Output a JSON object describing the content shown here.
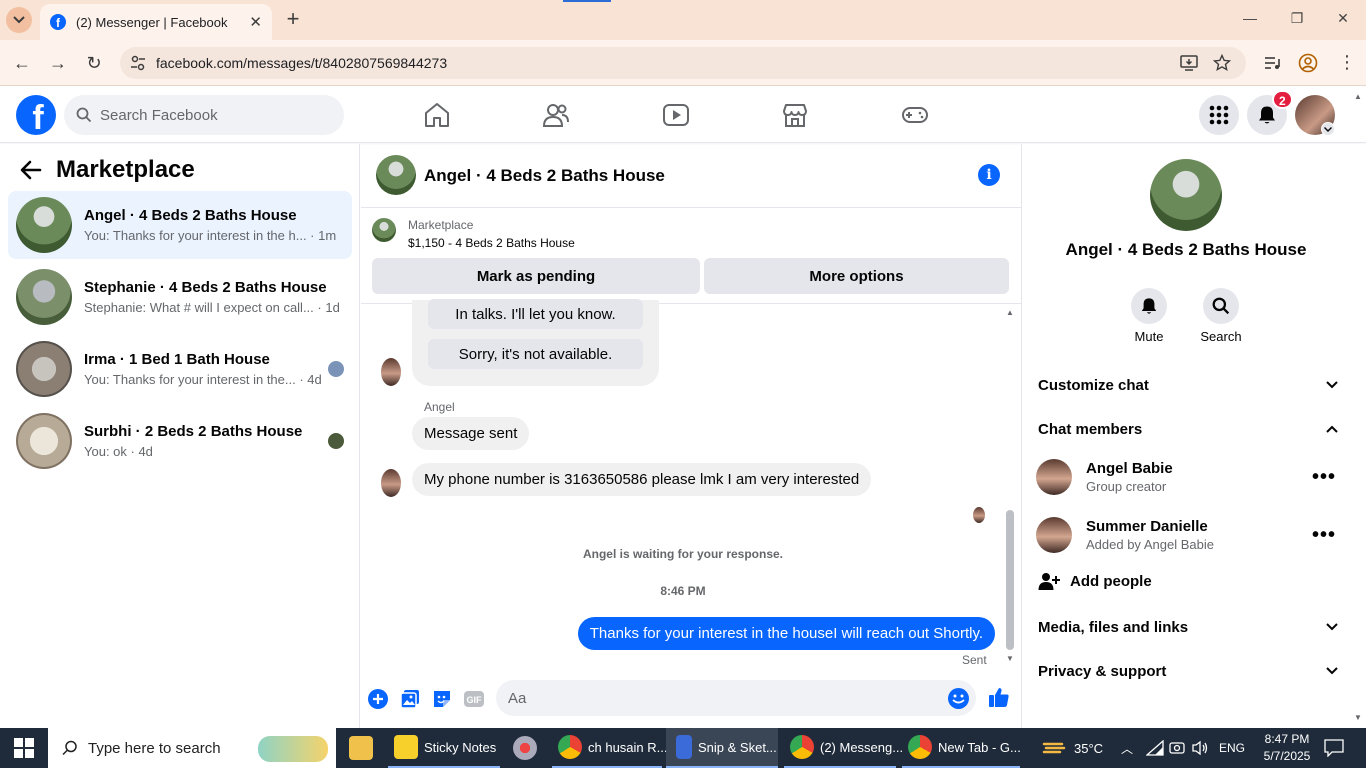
{
  "browser": {
    "tab_title": "(2) Messenger | Facebook",
    "close_tab": "✕",
    "new_tab": "+",
    "url": "facebook.com/messages/t/8402807569844273",
    "favicon_letter": "f"
  },
  "facebook": {
    "logo_letter": "f",
    "search_placeholder": "Search Facebook",
    "notification_count": "2"
  },
  "left_panel": {
    "title": "Marketplace",
    "conversations": [
      {
        "name": "Angel · 4 Beds 2 Baths House",
        "preview": "You: Thanks for your interest in the h... · 1m",
        "selected": true
      },
      {
        "name": "Stephanie · 4 Beds 2 Baths House",
        "preview": "Stephanie: What # will I expect on call... · 1d",
        "selected": false
      },
      {
        "name": "Irma · 1 Bed 1 Bath House",
        "preview": "You: Thanks for your interest in the... · 4d",
        "selected": false
      },
      {
        "name": "Surbhi · 2 Beds 2 Baths House",
        "preview": "You: ok · 4d",
        "selected": false
      }
    ]
  },
  "chat": {
    "title": "Angel · 4 Beds 2 Baths House",
    "marketplace_label": "Marketplace",
    "listing": "$1,150 - 4 Beds 2 Baths House",
    "mark_pending": "Mark as pending",
    "more_options": "More options",
    "quick_replies": [
      "In talks. I'll let you know.",
      "Sorry, it's not available."
    ],
    "sender_name": "Angel",
    "messages_in": [
      "Message sent",
      "My phone number is 3163650586 please lmk I am very interested"
    ],
    "waiting_notice": "Angel is waiting for your response.",
    "timestamp": "8:46 PM",
    "message_out": "Thanks for your interest in the houseI will reach out Shortly.",
    "sent_label": "Sent",
    "composer_placeholder": "Aa"
  },
  "right_panel": {
    "name": "Angel · 4 Beds 2 Baths House",
    "mute_label": "Mute",
    "search_label": "Search",
    "customize_chat": "Customize chat",
    "chat_members": "Chat members",
    "members": [
      {
        "name": "Angel Babie",
        "role": "Group creator"
      },
      {
        "name": "Summer Danielle",
        "role": "Added by Angel Babie"
      }
    ],
    "add_people": "Add people",
    "media_files_links": "Media, files and links",
    "privacy_support": "Privacy & support"
  },
  "taskbar": {
    "search_placeholder": "Type here to search",
    "apps": [
      {
        "label": "Sticky Notes"
      },
      {
        "label": "ch husain R..."
      },
      {
        "label": "Snip & Sket..."
      },
      {
        "label": "(2) Messeng..."
      },
      {
        "label": "New Tab - G..."
      }
    ],
    "temperature": "35°C",
    "language": "ENG",
    "time": "8:47 PM",
    "date": "5/7/2025"
  }
}
